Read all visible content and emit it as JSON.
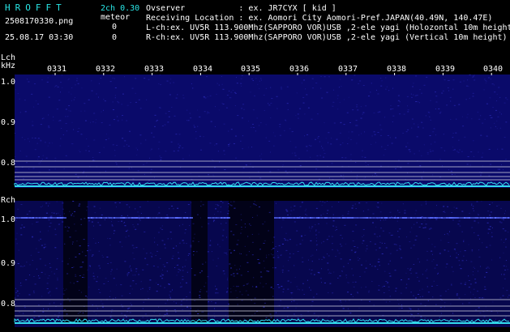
{
  "header": {
    "brand": "HROFFT",
    "mode": "2ch 0.30",
    "filename": "2508170330.png",
    "meteor_label": "meteor",
    "datetime": "25.08.17 03:30",
    "count_lch": "0",
    "count_rch": "0",
    "observer_line": "Ovserver           : ex. JR7CYX [ kid ]",
    "location_line": "Receiving Location : ex. Aomori City Aomori-Pref.JAPAN(40.49N, 140.47E)",
    "lch_line": "L-ch:ex. UV5R 113.900Mhz(SAPPORO VOR)USB ,2-ele yagi (Holozontal 10m height",
    "rch_line": "R-ch:ex. UV5R 113.900Mhz(SAPPORO VOR)USB ,2-ele yagi (Vertical 10m height)"
  },
  "lch_panel": {
    "label": "Lch",
    "unit": "kHz",
    "ticks": [
      "1.0",
      "0.9",
      "0.8"
    ]
  },
  "rch_panel": {
    "label": "Rch",
    "ticks": [
      "1.0",
      "0.9",
      "0.8"
    ]
  },
  "time_ticks": [
    "0331",
    "0332",
    "0333",
    "0334",
    "0335",
    "0336",
    "0337",
    "0338",
    "0339",
    "0340"
  ],
  "colors": {
    "background": "#000000",
    "cyan_text": "#29e6e6",
    "noise_trace": "#33ddee",
    "carrier": "#5a6cff",
    "spectrogram": "#0a0a6a"
  }
}
